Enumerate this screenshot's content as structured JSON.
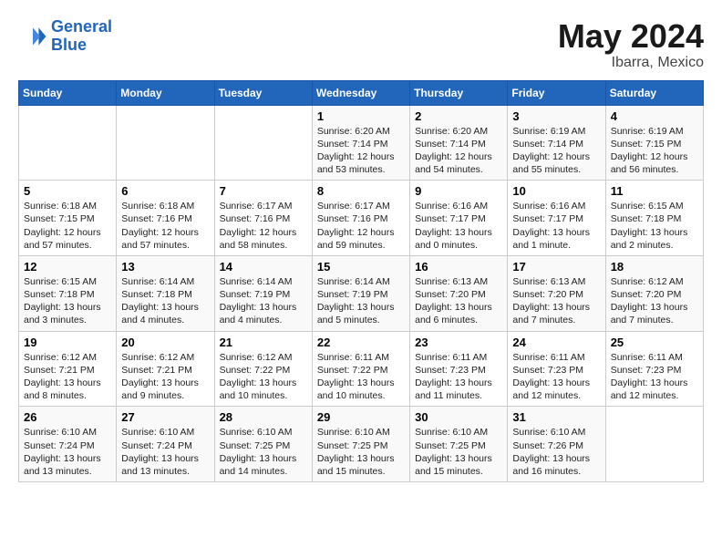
{
  "header": {
    "logo_line1": "General",
    "logo_line2": "Blue",
    "month_year": "May 2024",
    "location": "Ibarra, Mexico"
  },
  "weekdays": [
    "Sunday",
    "Monday",
    "Tuesday",
    "Wednesday",
    "Thursday",
    "Friday",
    "Saturday"
  ],
  "weeks": [
    [
      {
        "day": "",
        "detail": ""
      },
      {
        "day": "",
        "detail": ""
      },
      {
        "day": "",
        "detail": ""
      },
      {
        "day": "1",
        "detail": "Sunrise: 6:20 AM\nSunset: 7:14 PM\nDaylight: 12 hours\nand 53 minutes."
      },
      {
        "day": "2",
        "detail": "Sunrise: 6:20 AM\nSunset: 7:14 PM\nDaylight: 12 hours\nand 54 minutes."
      },
      {
        "day": "3",
        "detail": "Sunrise: 6:19 AM\nSunset: 7:14 PM\nDaylight: 12 hours\nand 55 minutes."
      },
      {
        "day": "4",
        "detail": "Sunrise: 6:19 AM\nSunset: 7:15 PM\nDaylight: 12 hours\nand 56 minutes."
      }
    ],
    [
      {
        "day": "5",
        "detail": "Sunrise: 6:18 AM\nSunset: 7:15 PM\nDaylight: 12 hours\nand 57 minutes."
      },
      {
        "day": "6",
        "detail": "Sunrise: 6:18 AM\nSunset: 7:16 PM\nDaylight: 12 hours\nand 57 minutes."
      },
      {
        "day": "7",
        "detail": "Sunrise: 6:17 AM\nSunset: 7:16 PM\nDaylight: 12 hours\nand 58 minutes."
      },
      {
        "day": "8",
        "detail": "Sunrise: 6:17 AM\nSunset: 7:16 PM\nDaylight: 12 hours\nand 59 minutes."
      },
      {
        "day": "9",
        "detail": "Sunrise: 6:16 AM\nSunset: 7:17 PM\nDaylight: 13 hours\nand 0 minutes."
      },
      {
        "day": "10",
        "detail": "Sunrise: 6:16 AM\nSunset: 7:17 PM\nDaylight: 13 hours\nand 1 minute."
      },
      {
        "day": "11",
        "detail": "Sunrise: 6:15 AM\nSunset: 7:18 PM\nDaylight: 13 hours\nand 2 minutes."
      }
    ],
    [
      {
        "day": "12",
        "detail": "Sunrise: 6:15 AM\nSunset: 7:18 PM\nDaylight: 13 hours\nand 3 minutes."
      },
      {
        "day": "13",
        "detail": "Sunrise: 6:14 AM\nSunset: 7:18 PM\nDaylight: 13 hours\nand 4 minutes."
      },
      {
        "day": "14",
        "detail": "Sunrise: 6:14 AM\nSunset: 7:19 PM\nDaylight: 13 hours\nand 4 minutes."
      },
      {
        "day": "15",
        "detail": "Sunrise: 6:14 AM\nSunset: 7:19 PM\nDaylight: 13 hours\nand 5 minutes."
      },
      {
        "day": "16",
        "detail": "Sunrise: 6:13 AM\nSunset: 7:20 PM\nDaylight: 13 hours\nand 6 minutes."
      },
      {
        "day": "17",
        "detail": "Sunrise: 6:13 AM\nSunset: 7:20 PM\nDaylight: 13 hours\nand 7 minutes."
      },
      {
        "day": "18",
        "detail": "Sunrise: 6:12 AM\nSunset: 7:20 PM\nDaylight: 13 hours\nand 7 minutes."
      }
    ],
    [
      {
        "day": "19",
        "detail": "Sunrise: 6:12 AM\nSunset: 7:21 PM\nDaylight: 13 hours\nand 8 minutes."
      },
      {
        "day": "20",
        "detail": "Sunrise: 6:12 AM\nSunset: 7:21 PM\nDaylight: 13 hours\nand 9 minutes."
      },
      {
        "day": "21",
        "detail": "Sunrise: 6:12 AM\nSunset: 7:22 PM\nDaylight: 13 hours\nand 10 minutes."
      },
      {
        "day": "22",
        "detail": "Sunrise: 6:11 AM\nSunset: 7:22 PM\nDaylight: 13 hours\nand 10 minutes."
      },
      {
        "day": "23",
        "detail": "Sunrise: 6:11 AM\nSunset: 7:23 PM\nDaylight: 13 hours\nand 11 minutes."
      },
      {
        "day": "24",
        "detail": "Sunrise: 6:11 AM\nSunset: 7:23 PM\nDaylight: 13 hours\nand 12 minutes."
      },
      {
        "day": "25",
        "detail": "Sunrise: 6:11 AM\nSunset: 7:23 PM\nDaylight: 13 hours\nand 12 minutes."
      }
    ],
    [
      {
        "day": "26",
        "detail": "Sunrise: 6:10 AM\nSunset: 7:24 PM\nDaylight: 13 hours\nand 13 minutes."
      },
      {
        "day": "27",
        "detail": "Sunrise: 6:10 AM\nSunset: 7:24 PM\nDaylight: 13 hours\nand 13 minutes."
      },
      {
        "day": "28",
        "detail": "Sunrise: 6:10 AM\nSunset: 7:25 PM\nDaylight: 13 hours\nand 14 minutes."
      },
      {
        "day": "29",
        "detail": "Sunrise: 6:10 AM\nSunset: 7:25 PM\nDaylight: 13 hours\nand 15 minutes."
      },
      {
        "day": "30",
        "detail": "Sunrise: 6:10 AM\nSunset: 7:25 PM\nDaylight: 13 hours\nand 15 minutes."
      },
      {
        "day": "31",
        "detail": "Sunrise: 6:10 AM\nSunset: 7:26 PM\nDaylight: 13 hours\nand 16 minutes."
      },
      {
        "day": "",
        "detail": ""
      }
    ]
  ]
}
